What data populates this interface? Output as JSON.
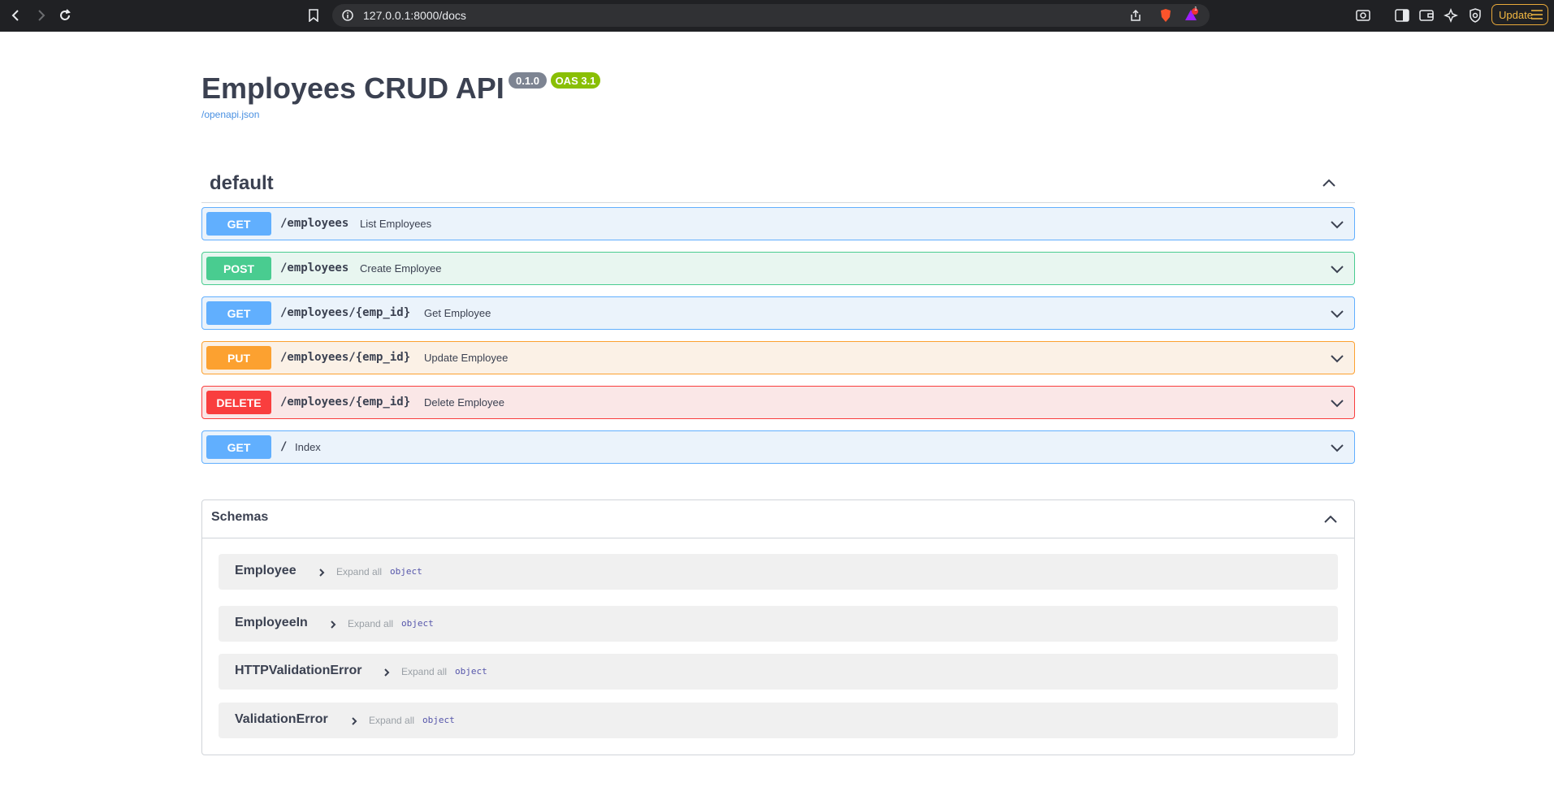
{
  "browser": {
    "url": "127.0.0.1:8000/docs",
    "update_label": "Update",
    "notification_count": "1"
  },
  "api": {
    "title": "Employees CRUD API",
    "version": "0.1.0",
    "oas": "OAS 3.1",
    "openapi_link": "/openapi.json"
  },
  "tag": {
    "name": "default"
  },
  "operations": [
    {
      "method": "GET",
      "path": "/employees",
      "summary": "List Employees"
    },
    {
      "method": "POST",
      "path": "/employees",
      "summary": "Create Employee"
    },
    {
      "method": "GET",
      "path": "/employees/{emp_id}",
      "summary": "Get Employee"
    },
    {
      "method": "PUT",
      "path": "/employees/{emp_id}",
      "summary": "Update Employee"
    },
    {
      "method": "DELETE",
      "path": "/employees/{emp_id}",
      "summary": "Delete Employee"
    },
    {
      "method": "GET",
      "path": "/",
      "summary": "Index"
    }
  ],
  "schemas": {
    "title": "Schemas",
    "items": [
      {
        "name": "Employee",
        "expand": "Expand all",
        "type": "object"
      },
      {
        "name": "EmployeeIn",
        "expand": "Expand all",
        "type": "object"
      },
      {
        "name": "HTTPValidationError",
        "expand": "Expand all",
        "type": "object"
      },
      {
        "name": "ValidationError",
        "expand": "Expand all",
        "type": "object"
      }
    ]
  },
  "colors": {
    "get": "#61affe",
    "post": "#49cc90",
    "put": "#fca130",
    "delete": "#f93e3e"
  }
}
